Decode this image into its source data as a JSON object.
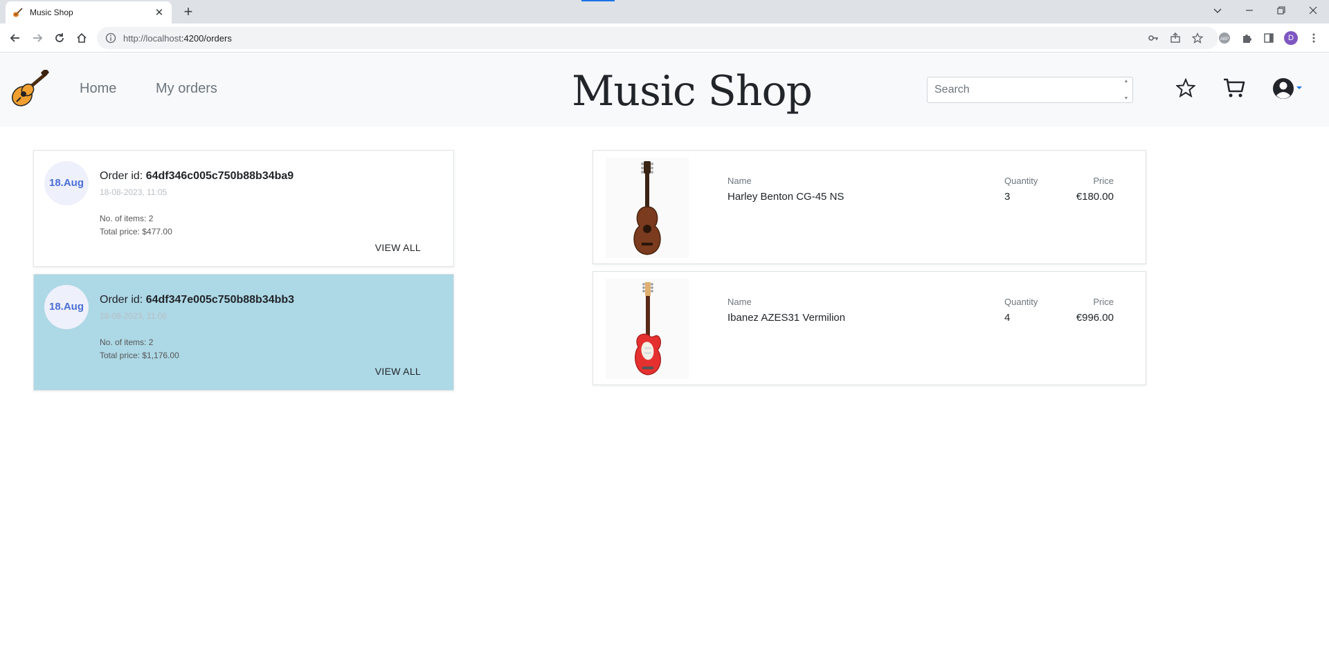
{
  "browser": {
    "tab_title": "Music Shop",
    "url_host": "http://localhost",
    "url_rest": ":4200/orders",
    "profile_initial": "D"
  },
  "nav": {
    "links": [
      "Home",
      "My orders"
    ],
    "brand": "Music Shop",
    "search_placeholder": "Search"
  },
  "orders": [
    {
      "date_badge": "18.Aug",
      "id_label": "Order id: ",
      "id": "64df346c005c750b88b34ba9",
      "timestamp": "18-08-2023, 11:05",
      "items": "No. of items: 2",
      "total": "Total price: $477.00",
      "view_all": "VIEW ALL",
      "selected": false
    },
    {
      "date_badge": "18.Aug",
      "id_label": "Order id: ",
      "id": "64df347e005c750b88b34bb3",
      "timestamp": "18-08-2023, 11:06",
      "items": "No. of items: 2",
      "total": "Total price: $1,176.00",
      "view_all": "VIEW ALL",
      "selected": true
    }
  ],
  "items": [
    {
      "name_label": "Name",
      "name": "Harley Benton CG-45 NS",
      "qty_label": "Quantity",
      "qty": "3",
      "price_label": "Price",
      "price": "€180.00",
      "image": "acoustic-guitar-icon"
    },
    {
      "name_label": "Name",
      "name": "Ibanez AZES31 Vermilion",
      "qty_label": "Quantity",
      "qty": "4",
      "price_label": "Price",
      "price": "€996.00",
      "image": "electric-guitar-icon"
    }
  ],
  "colors": {
    "selected_order_bg": "#add8e6",
    "date_badge_text": "#4a6ed6",
    "navbar_bg": "#f8f9fa"
  }
}
